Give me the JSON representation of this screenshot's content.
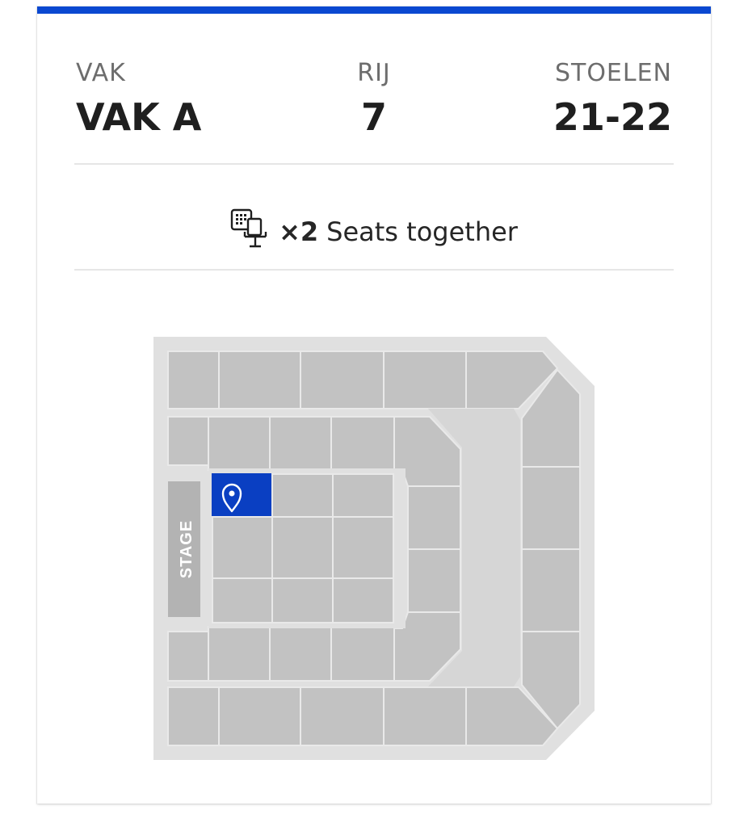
{
  "ticket": {
    "section": {
      "label": "VAK",
      "value": "VAK A"
    },
    "row": {
      "label": "RIJ",
      "value": "7"
    },
    "seats": {
      "label": "STOELEN",
      "value": "21-22"
    }
  },
  "together": {
    "count": "×2",
    "text": "Seats together",
    "icon": "seats-together-icon"
  },
  "map": {
    "stage_label": "STAGE",
    "selected_color": "#0a3fc2",
    "block_color": "#c2c2c2",
    "venue_color": "#e0e0e0",
    "pin_icon": "location-pin-icon"
  },
  "accent": "#0a48d1"
}
